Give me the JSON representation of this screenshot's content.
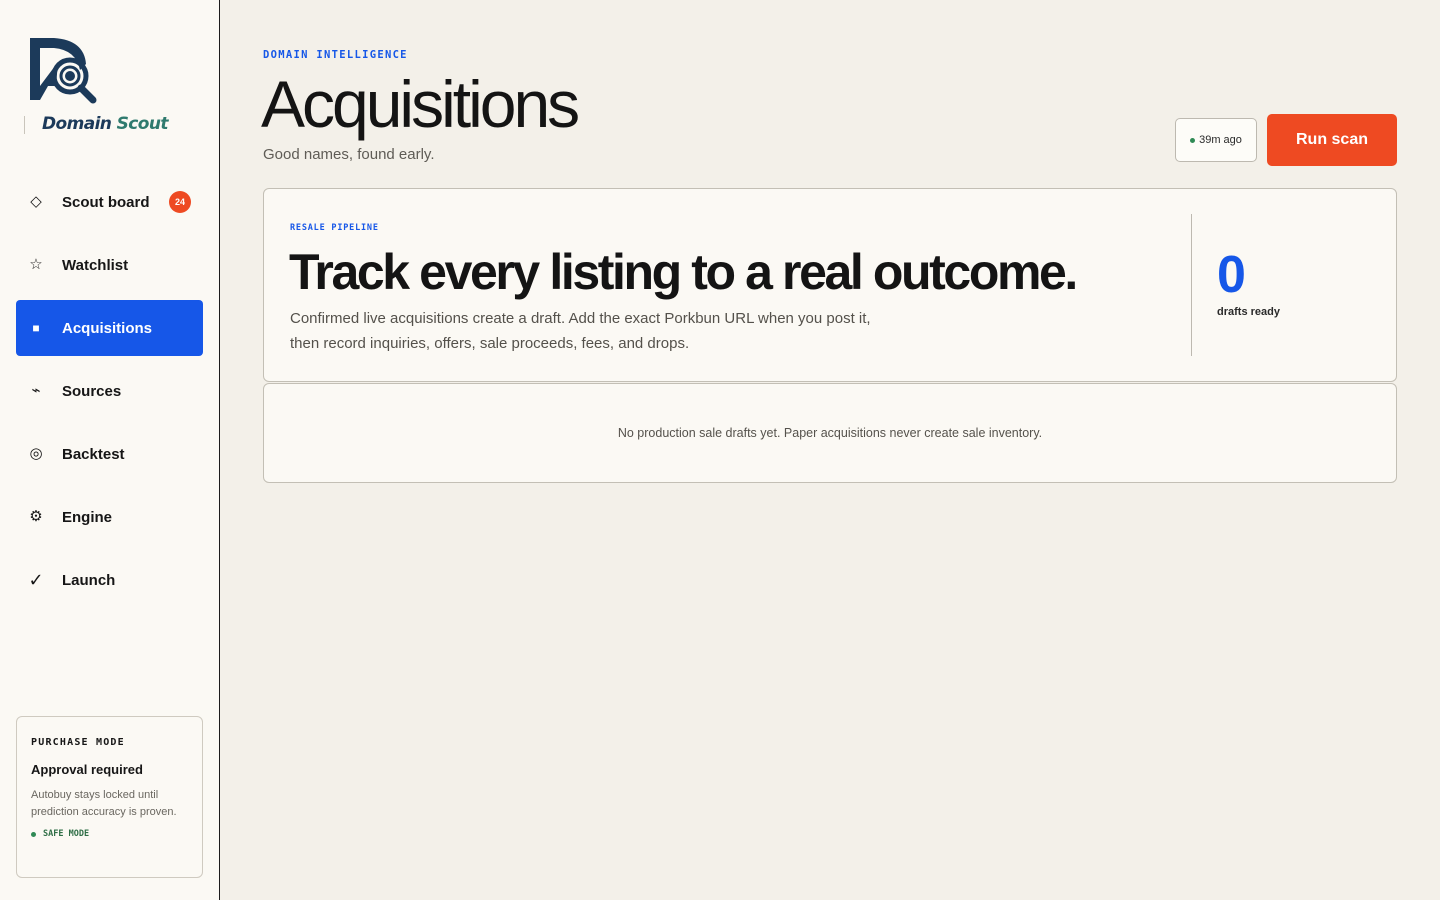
{
  "brand": {
    "name_part1": "Domain",
    "name_part2": "Scout",
    "logo_icon": "magnifier-d-icon",
    "colors": {
      "navy": "#1c3a5a",
      "teal": "#2f7a6e"
    }
  },
  "sidebar": {
    "items": [
      {
        "label": "Scout board",
        "icon": "diamond-icon",
        "glyph": "◇",
        "badge": "24",
        "active": false
      },
      {
        "label": "Watchlist",
        "icon": "star-icon",
        "glyph": "☆",
        "active": false
      },
      {
        "label": "Acquisitions",
        "icon": "square-icon",
        "glyph": "■",
        "active": true
      },
      {
        "label": "Sources",
        "icon": "signal-icon",
        "glyph": "⌁",
        "active": false
      },
      {
        "label": "Backtest",
        "icon": "target-icon",
        "glyph": "◎",
        "active": false
      },
      {
        "label": "Engine",
        "icon": "gear-icon",
        "glyph": "⚙",
        "active": false
      },
      {
        "label": "Launch",
        "icon": "check-icon",
        "glyph": "✓",
        "active": false
      }
    ],
    "purchase_mode": {
      "title": "PURCHASE MODE",
      "heading": "Approval required",
      "description": "Autobuy stays locked until prediction accuracy is proven.",
      "status": "SAFE MODE"
    }
  },
  "header": {
    "eyebrow": "DOMAIN INTELLIGENCE",
    "title": "Acquisitions",
    "subtitle": "Good names, found early.",
    "last_scan": "39m ago",
    "run_button": "Run scan"
  },
  "pipeline": {
    "eyebrow": "RESALE PIPELINE",
    "title": "Track every listing to a real outcome.",
    "description_line1": "Confirmed live acquisitions create a draft. Add the exact Porkbun URL when you post it,",
    "description_line2": "then record inquiries, offers, sale proceeds, fees, and drops.",
    "count": "0",
    "count_label": "drafts ready"
  },
  "empty_state": {
    "message": "No production sale drafts yet. Paper acquisitions never create sale inventory."
  },
  "colors": {
    "accent_blue": "#1657e8",
    "accent_orange": "#ee4a22",
    "status_green": "#2f8a55",
    "background": "#f3f0e9"
  }
}
